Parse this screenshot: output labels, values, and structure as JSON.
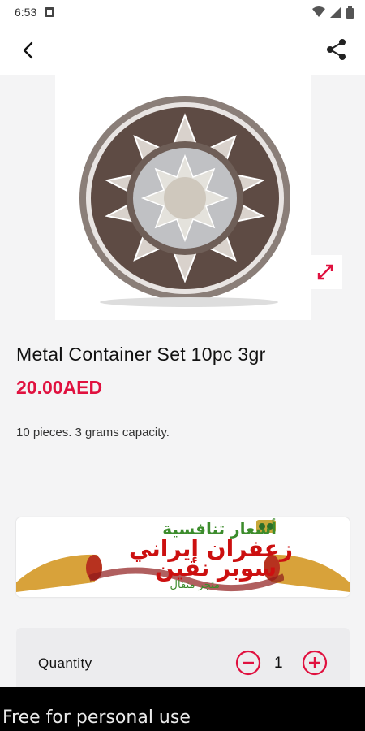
{
  "status_bar": {
    "time": "6:53"
  },
  "product": {
    "title": "Metal Container Set 10pc 3gr",
    "price": "20.00AED",
    "description": "10 pieces. 3 grams capacity."
  },
  "banner": {
    "line1": "أسعار تنافسية",
    "line2": "زعفران إيراني",
    "line3": "سوبر نقين",
    "line4": "متجر مثقال"
  },
  "quantity": {
    "label": "Quantity",
    "value": "1"
  },
  "watermark": {
    "text": "Free for personal use"
  },
  "colors": {
    "accent": "#e0113f"
  },
  "icons": {
    "back": "back-arrow-icon",
    "share": "share-icon",
    "expand": "expand-icon",
    "minus": "minus-circle-icon",
    "plus": "plus-circle-icon"
  }
}
